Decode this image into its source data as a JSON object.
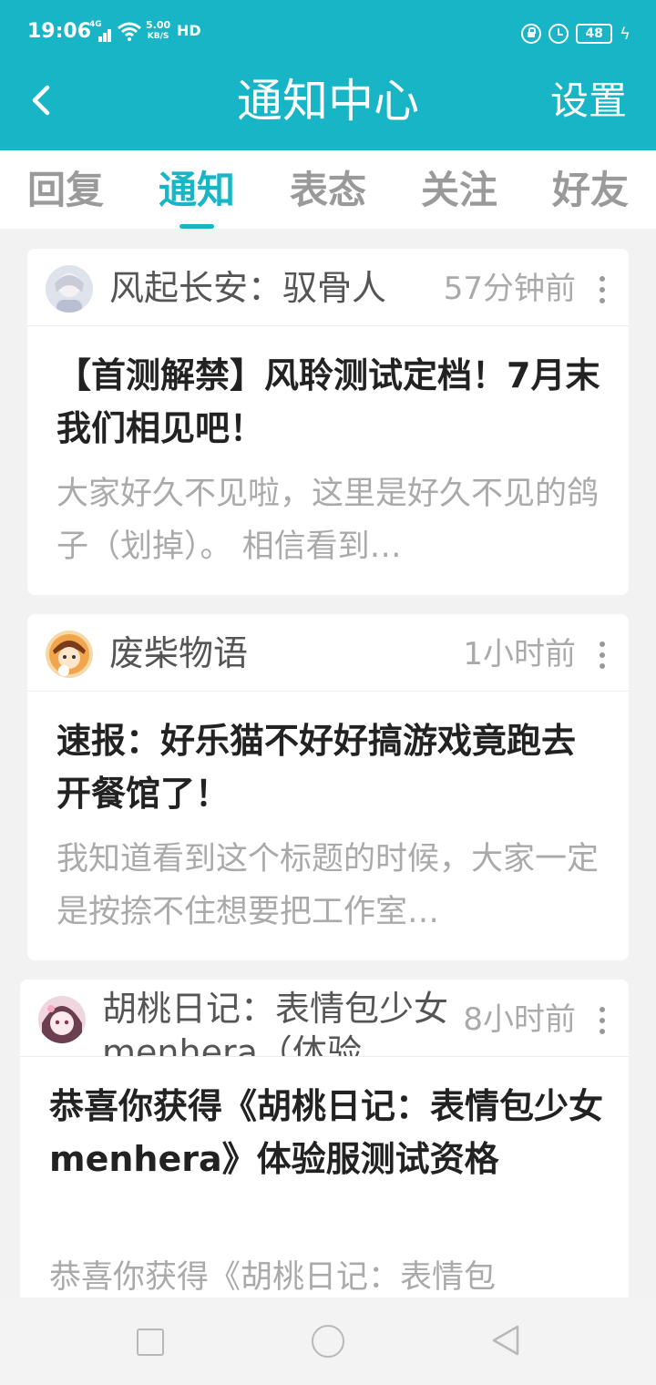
{
  "status_bar": {
    "time": "19:06",
    "network": "4G",
    "speed_value": "5.00",
    "speed_unit": "KB/S",
    "hd": "HD",
    "battery": "48",
    "icons": [
      "signal-icon",
      "wifi-icon",
      "lock-rotation-icon",
      "alarm-icon",
      "battery-icon",
      "charging-icon"
    ]
  },
  "header": {
    "title": "通知中心",
    "settings_label": "设置",
    "back_icon": "chevron-left-icon",
    "background": "#18b5c6"
  },
  "tabs": [
    {
      "label": "回复",
      "active": false
    },
    {
      "label": "通知",
      "active": true
    },
    {
      "label": "表态",
      "active": false
    },
    {
      "label": "关注",
      "active": false
    },
    {
      "label": "好友",
      "active": false
    }
  ],
  "accent_color": "#18b5c6",
  "notifications": [
    {
      "author": "风起长安：驭骨人",
      "time": "57分钟前",
      "headline": "【首测解禁】风聆测试定档！7月末我们相见吧！",
      "summary": "大家好久不见啦，这里是好久不见的鸽子（划掉）。 相信看到…"
    },
    {
      "author": "废柴物语",
      "time": "1小时前",
      "headline": "速报：好乐猫不好好搞游戏竟跑去开餐馆了！",
      "summary": "我知道看到这个标题的时候，大家一定是按捺不住想要把工作室…"
    },
    {
      "author": "胡桃日记：表情包少女menhera（体验",
      "time": "8小时前",
      "headline": "恭喜你获得《胡桃日记：表情包少女menhera》体验服测试资格",
      "summary": "恭喜你获得《胡桃日记：表情包"
    }
  ],
  "nav_bar": {
    "icons": [
      "recent-apps-icon",
      "home-icon",
      "back-icon"
    ]
  }
}
